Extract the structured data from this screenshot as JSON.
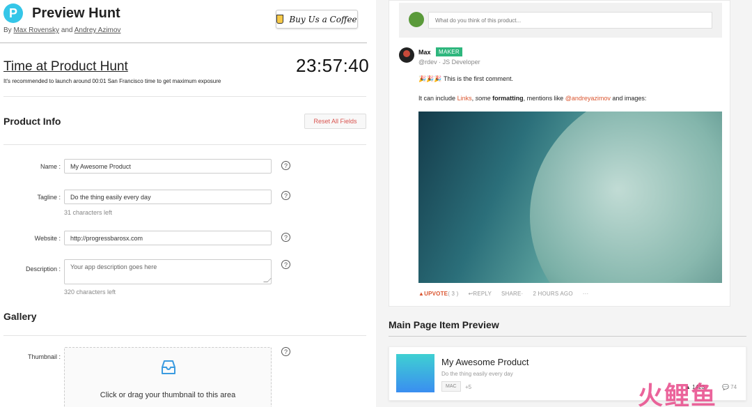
{
  "header": {
    "title": "Preview Hunt",
    "logo_letter": "P",
    "by_prefix": "By",
    "author1": "Max Rovensky",
    "and": "and",
    "author2": "Andrey Azimov",
    "coffee_label": "Buy Us a Coffee"
  },
  "time": {
    "title": "Time at Product Hunt",
    "note": "It's recommended to launch around 00:01 San Francisco time to get maximum exposure",
    "clock": "23:57:40"
  },
  "product_info": {
    "heading": "Product Info",
    "reset_label": "Reset All Fields",
    "fields": {
      "name": {
        "label": "Name",
        "value": "My Awesome Product"
      },
      "tagline": {
        "label": "Tagline",
        "value": "Do the thing easily every day",
        "hint": "31 characters left"
      },
      "website": {
        "label": "Website",
        "value": "http://progressbarosx.com"
      },
      "description": {
        "label": "Description",
        "placeholder": "Your app description goes here",
        "hint": "320 characters left"
      }
    },
    "help_glyph": "?"
  },
  "gallery": {
    "heading": "Gallery",
    "thumbnail_label": "Thumbnail",
    "dropzone_text": "Click or drag your thumbnail to this area"
  },
  "comment": {
    "input_placeholder": "What do you think of this product...",
    "author": "Max",
    "badge": "MAKER",
    "handle": "@rdev · JS Developer",
    "line1_emoji": "🎉🎉🎉",
    "line1_text": "This is the first comment.",
    "line2": {
      "p1": "It can include",
      "link": "Links",
      "p2": ",",
      "italic": "some",
      "bold": "formatting",
      "p3": ", mentions like",
      "mention": "@andreyazimov",
      "p4": "and images:"
    },
    "actions": {
      "upvote": "▲UPVOTE",
      "upvote_count": "( 3 )",
      "reply": "↩REPLY",
      "share": "SHARE·",
      "time": "2 HOURS AGO",
      "more": "···"
    }
  },
  "preview": {
    "heading": "Main Page Item Preview",
    "name": "My Awesome Product",
    "tagline": "Do the thing easily every day",
    "platform": "MAC",
    "more": "+5",
    "votes": "▲ 1423",
    "comments": "💬 74"
  },
  "watermark": "火鲤鱼",
  "colors": {
    "accent": "#da552f",
    "maker": "#2eb67d",
    "logo": "#35c6e8",
    "reset": "#d9534f"
  }
}
